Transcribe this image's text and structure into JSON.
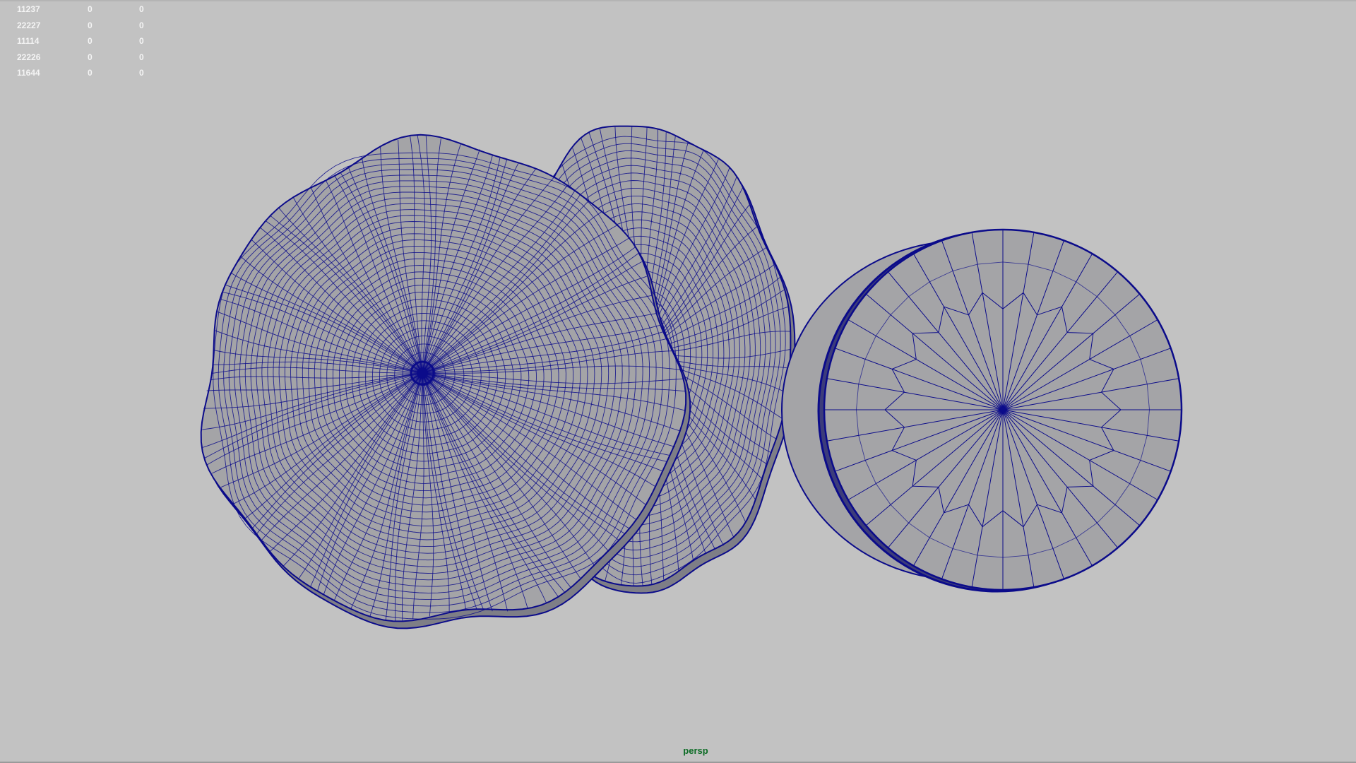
{
  "hud": {
    "rows": [
      {
        "c0": "11237",
        "c1": "0",
        "c2": "0"
      },
      {
        "c0": "22227",
        "c1": "0",
        "c2": "0"
      },
      {
        "c0": "11114",
        "c1": "0",
        "c2": "0"
      },
      {
        "c0": "22226",
        "c1": "0",
        "c2": "0"
      },
      {
        "c0": "11644",
        "c1": "0",
        "c2": "0"
      }
    ]
  },
  "viewport": {
    "camera": "persp",
    "colors": {
      "background": "#c2c2c2",
      "mesh_fill": "#a4a4a7",
      "wire": "#0b0b8a",
      "camera_label": "#0b6b24",
      "hud_text": "#f4f4f4"
    }
  }
}
